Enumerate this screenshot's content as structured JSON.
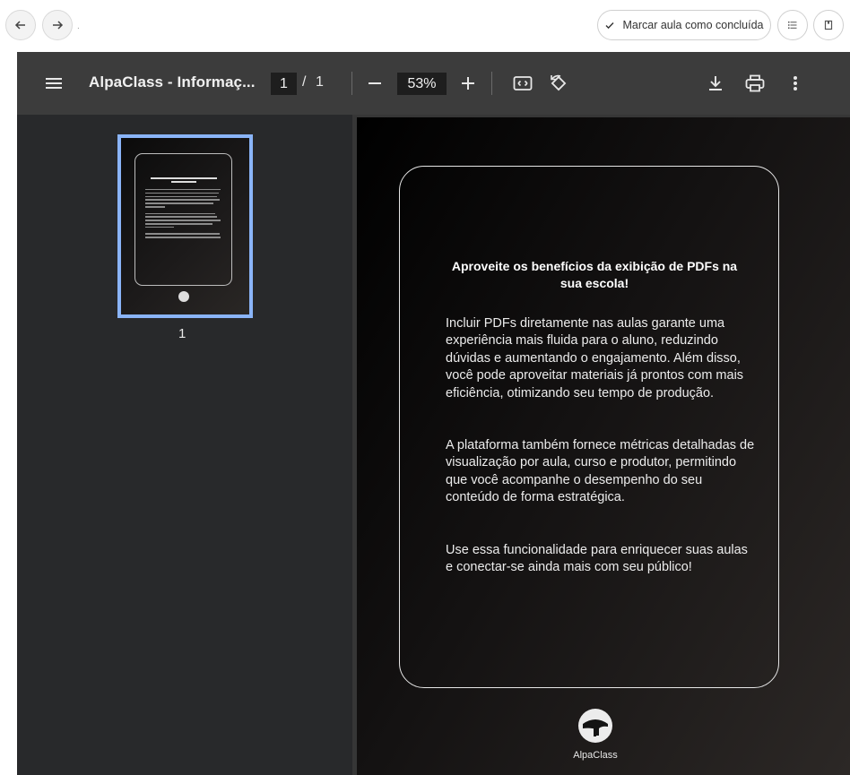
{
  "nav": {
    "back_icon": "arrow-left-icon",
    "forward_icon": "arrow-right-icon",
    "dot": ".",
    "complete_label": "Marcar aula como concluída",
    "list_icon": "list-icon",
    "bookmark_icon": "bookmark-icon"
  },
  "viewer": {
    "title": "AlpaClass - Informaç...",
    "current_page": "1",
    "page_separator": "/",
    "total_pages": "1",
    "zoom": "53%",
    "thumbnail_label": "1"
  },
  "document": {
    "title": "Aproveite os benefícios da exibição de PDFs na sua escola!",
    "paragraphs": [
      "Incluir PDFs diretamente nas aulas garante uma experiência mais fluida para o aluno, reduzindo dúvidas e aumentando o engajamento. Além disso, você pode aproveitar materiais já prontos com mais eficiência, otimizando seu tempo de produção.",
      "A plataforma também fornece métricas detalhadas de visualização por aula, curso e produtor, permitindo que você acompanhe o desempenho do seu conteúdo de forma estratégica.",
      "Use essa funcionalidade para enriquecer suas aulas e conectar-se ainda mais com seu público!"
    ],
    "logo_text": "AlpaClass"
  },
  "colors": {
    "toolbar": "#3c3c3c",
    "sidebar": "#28292b",
    "thumb_selection": "#8ab4f8"
  }
}
